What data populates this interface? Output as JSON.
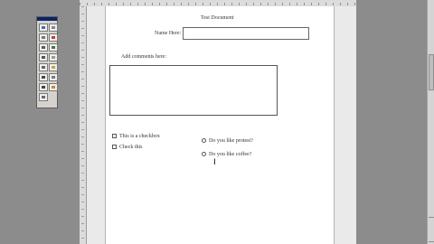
{
  "form": {
    "title": "Test Document",
    "name_label": "Name Here:",
    "comments_label": "Add comments here:",
    "checkbox1_label": "This is a checkbox",
    "checkbox2_label": "Check this",
    "radio1_label": "Do you like protest?",
    "radio2_label": "Do you like coffee?"
  },
  "icons": {
    "cursor": "I-beam text cursor",
    "toolbox": "form controls toolbox"
  }
}
